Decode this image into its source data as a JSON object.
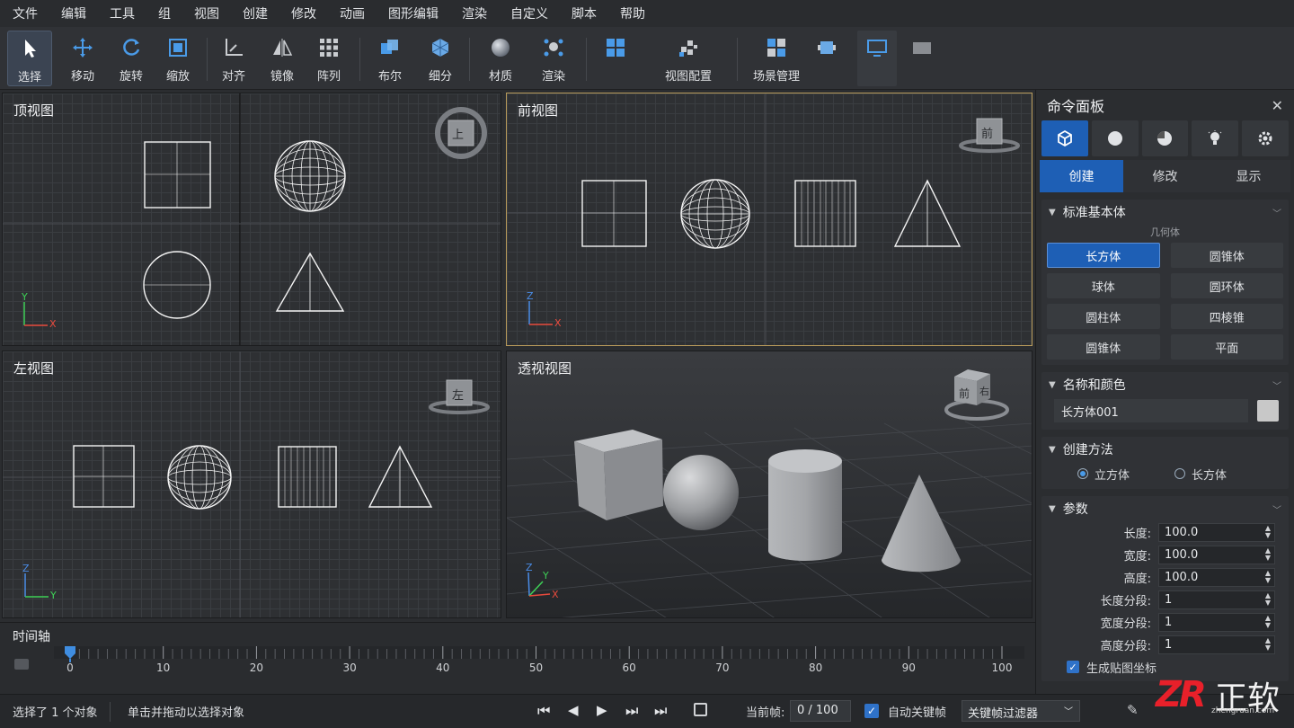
{
  "menu": [
    "文件",
    "编辑",
    "工具",
    "组",
    "视图",
    "创建",
    "修改",
    "动画",
    "图形编辑",
    "渲染",
    "自定义",
    "脚本",
    "帮助"
  ],
  "toolbar": {
    "select": "选择",
    "move": "移动",
    "rotate": "旋转",
    "scale": "缩放",
    "align": "对齐",
    "mirror": "镜像",
    "array": "阵列",
    "boolean": "布尔",
    "subdivide": "细分",
    "material": "材质",
    "render": "渲染",
    "viewport_config": "视图配置",
    "scene_manager": "场景管理"
  },
  "viewports": {
    "top": {
      "title": "顶视图",
      "cube": "上",
      "axis_v": "Y",
      "axis_h": "X"
    },
    "front": {
      "title": "前视图",
      "cube": "前",
      "axis_v": "Z",
      "axis_h": "X"
    },
    "left": {
      "title": "左视图",
      "cube": "左",
      "axis_v": "Z",
      "axis_h": "Y"
    },
    "persp": {
      "title": "透视视图",
      "cube_front": "前",
      "cube_right": "右",
      "axis_z": "Z",
      "axis_y": "Y",
      "axis_x": "X"
    }
  },
  "panel": {
    "title": "命令面板",
    "tabs": [
      "创建",
      "修改",
      "显示"
    ],
    "primitives": {
      "section": "标准基本体",
      "category": "几何体",
      "buttons": [
        "长方体",
        "圆锥体",
        "球体",
        "圆环体",
        "圆柱体",
        "四棱锥",
        "圆锥体",
        "平面"
      ]
    },
    "name_color": {
      "section": "名称和颜色",
      "name": "长方体001",
      "swatch": "#c8c8c8"
    },
    "method": {
      "section": "创建方法",
      "opt1": "立方体",
      "opt2": "长方体"
    },
    "params": {
      "section": "参数",
      "rows": [
        {
          "label": "长度:",
          "value": "100.0"
        },
        {
          "label": "宽度:",
          "value": "100.0"
        },
        {
          "label": "高度:",
          "value": "100.0"
        },
        {
          "label": "长度分段:",
          "value": "1"
        },
        {
          "label": "宽度分段:",
          "value": "1"
        },
        {
          "label": "高度分段:",
          "value": "1"
        }
      ],
      "uv": "生成贴图坐标"
    }
  },
  "timeline": {
    "title": "时间轴",
    "ticks": [
      "0",
      "10",
      "20",
      "30",
      "40",
      "50",
      "60",
      "70",
      "80",
      "90",
      "100"
    ],
    "current": 0,
    "max": 100
  },
  "status": {
    "selection": "选择了 1 个对象",
    "hint": "单击并拖动以选择对象",
    "frame_label": "当前帧:",
    "frame_value": "0 / 100",
    "autokey": "自动关键帧",
    "filter": "关键帧过滤器"
  },
  "watermark": {
    "logo": "ZR",
    "text": "正软",
    "url": "zhengruan.com"
  },
  "colors": {
    "accent": "#1e5fb5",
    "icon_blue": "#4a9be8",
    "active_border": "#b89a5a"
  }
}
